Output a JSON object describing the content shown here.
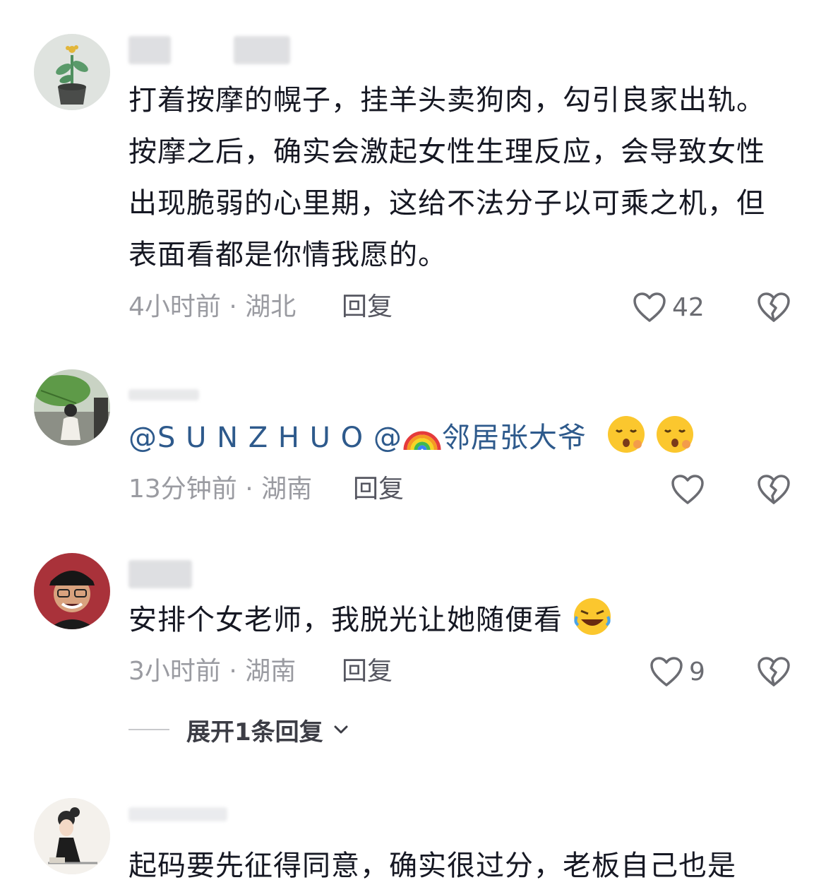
{
  "comments": [
    {
      "avatar": "potted-plant",
      "username": "",
      "text": "打着按摩的幌子，挂羊头卖狗肉，勾引良家出轨。按摩之后，确实会激起女性生理反应，会导致女性出现脆弱的心里期，这给不法分子以可乘之机，但表面看都是你情我愿的。",
      "meta": "4小时前 · 湖北",
      "reply_label": "回复",
      "likes": "42"
    },
    {
      "avatar": "girl-under-leaf",
      "username": "",
      "mention_text": "@S U N Z H U O @",
      "mention2_text": "邻居张大爷",
      "rainbow_icon": "rainbow",
      "emoji": "sleepy-face",
      "meta": "13分钟前 · 湖南",
      "reply_label": "回复",
      "likes": ""
    },
    {
      "avatar": "man-with-cap",
      "username": "",
      "text": "安排个女老师，我脱光让她随便看",
      "emoji": "laughing-face",
      "meta": "3小时前 · 湖南",
      "reply_label": "回复",
      "likes": "9",
      "expand_label": "展开1条回复"
    },
    {
      "avatar": "girl-illustration",
      "username": "",
      "text": "起码要先征得同意，确实很过分，老板自己也是"
    }
  ],
  "colors": {
    "text": "#161823",
    "meta": "#9a9ba1",
    "mention": "#2e5a8c"
  }
}
